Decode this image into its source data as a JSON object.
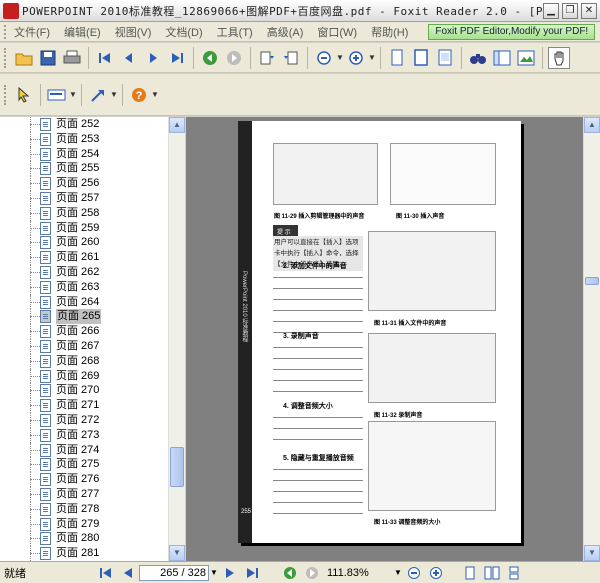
{
  "window": {
    "title": "POWERPOINT 2010标准教程_12869066+图解PDF+百度网盘.pdf - Foxit Reader 2.0 - [P...",
    "minimize_label": "▁",
    "restore_label": "❐",
    "close_label": "✕"
  },
  "menu": {
    "items": [
      "文件(F)",
      "编辑(E)",
      "视图(V)",
      "文档(D)",
      "工具(T)",
      "高级(A)",
      "窗口(W)",
      "帮助(H)"
    ],
    "ad_banner": "Foxit PDF Editor,Modify your PDF!"
  },
  "sidebar": {
    "pages": [
      "页面 252",
      "页面 253",
      "页面 254",
      "页面 255",
      "页面 256",
      "页面 257",
      "页面 258",
      "页面 259",
      "页面 260",
      "页面 261",
      "页面 262",
      "页面 263",
      "页面 264",
      "页面 265",
      "页面 266",
      "页面 267",
      "页面 268",
      "页面 269",
      "页面 270",
      "页面 271",
      "页面 272",
      "页面 273",
      "页面 274",
      "页面 275",
      "页面 276",
      "页面 277",
      "页面 278",
      "页面 279",
      "页面 280",
      "页面 281"
    ],
    "selected_index": 13
  },
  "document": {
    "captions": [
      "图 11-29  插入剪辑管理器中的声音",
      "图 11-30  插入声音",
      "图 11-31  插入文件中的声音",
      "图 11-32  录制声音",
      "图 11-33  调整音频的大小"
    ],
    "tip_label": "提 示",
    "tip_text": "用户可以直接在【插入】选项卡中执行【插入】命令，选择【文件中的声音】选项。",
    "headings": [
      "2. 添加文件中的声音",
      "3. 录制声音",
      "4. 调整音频大小",
      "5. 隐藏与重复播放音频"
    ],
    "side_text": "PowerPoint 2010 标准教程",
    "page_number": "255"
  },
  "status": {
    "ready": "就绪",
    "page_indicator": "265 / 328",
    "zoom": "111.83%"
  },
  "colors": {
    "toolbar_bg": "#ece9d8",
    "document_bg": "#808080",
    "selected_item": "#c0c0c0"
  }
}
